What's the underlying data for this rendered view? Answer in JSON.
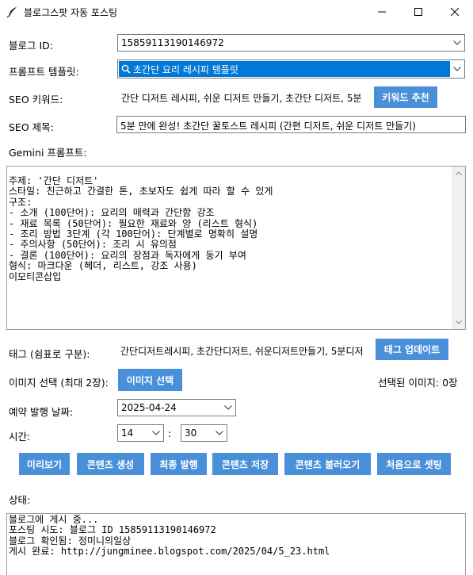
{
  "window": {
    "title": "블로그스팟 자동 포스팅",
    "app_icon": "feather-icon"
  },
  "form": {
    "blog_id_label": "블로그 ID:",
    "blog_id_value": "15859113190146972",
    "template_label": "프롬프트 템플릿:",
    "template_value": "초간단 요리 레시피 템플릿",
    "seo_keyword_label": "SEO 키워드:",
    "seo_keyword_value": "간단 디저트 레시피, 쉬운 디저트 만들기, 초간단 디저트, 5분",
    "keyword_recommend_label": "키워드 추천",
    "seo_title_label": "SEO 제목:",
    "seo_title_value": "5분 만에 완성! 초간단 꿀토스트 레시피 (간편 디저트, 쉬운 디저트 만들기)",
    "gemini_label": "Gemini 프롬프트:",
    "gemini_prompt": "주제: '간단 디저트'\n스타일: 친근하고 간결한 톤, 초보자도 쉽게 따라 할 수 있게\n구조:\n- 소개 (100단어): 요리의 매력과 간단함 강조\n- 재료 목록 (50단어): 필요한 재료와 양 (리스트 형식)\n- 조리 방법 3단계 (각 100단어): 단계별로 명확히 설명\n- 주의사항 (50단어): 조리 시 유의점\n- 결론 (100단어): 요리의 장점과 독자에게 동기 부여\n형식: 마크다운 (헤더, 리스트, 강조 사용)\n이모티콘삽입",
    "tags_label": "태그 (쉼표로 구분):",
    "tags_value": "간단디저트레시피, 초간단디저트, 쉬운디저트만들기, 5분디저",
    "tag_update_label": "태그 업데이트",
    "image_select_label": "이미지 선택 (최대 2장):",
    "image_select_button": "이미지 선택",
    "selected_images_text": "선택된 이미지: 0장",
    "date_label": "예약 발행 날짜:",
    "date_value": "2025-04-24",
    "time_label": "시간:",
    "hour_value": "14",
    "time_sep": ":",
    "minute_value": "30"
  },
  "actions": {
    "preview": "미리보기",
    "generate": "콘텐츠 생성",
    "publish": "최종 발행",
    "save": "콘텐츠 저장",
    "load": "콘텐츠 불러오기",
    "reset": "처음으로 셋팅"
  },
  "status": {
    "label": "상태:",
    "log": "블로그에 게시 중...\n포스팅 시도: 블로그 ID 15859113190146972\n블로그 확인됨: 정미니의일상\n게시 완료: http://jungminee.blogspot.com/2025/04/5_23.html"
  },
  "colors": {
    "button": "#4a90d9",
    "selection": "#0078d7"
  }
}
